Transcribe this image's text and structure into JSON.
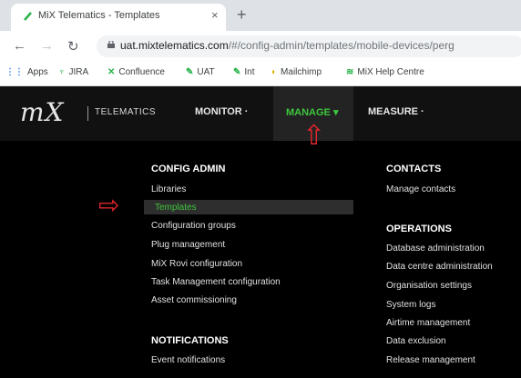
{
  "browser": {
    "tab_title": "MiX Telematics - Templates",
    "tab_close": "×",
    "new_tab": "+",
    "nav": {
      "back": "←",
      "forward": "→",
      "reload": "↻"
    },
    "url_host": "uat.mixtelematics.com",
    "url_path": "/#/config-admin/templates/mobile-devices/perg",
    "bookmarks": [
      {
        "icon": "apps-grid-icon",
        "glyph": "⋮⋮",
        "label": "Apps"
      },
      {
        "icon": "jira-icon",
        "glyph": "♆",
        "label": "JIRA"
      },
      {
        "icon": "confluence-icon",
        "glyph": "✕",
        "label": "Confluence"
      },
      {
        "icon": "leaf-icon",
        "glyph": "✎",
        "label": "UAT"
      },
      {
        "icon": "leaf-icon",
        "glyph": "✎",
        "label": "Int"
      },
      {
        "icon": "mailchimp-icon",
        "glyph": "◐",
        "label": "Mailchimp"
      },
      {
        "icon": "mix-help-icon",
        "glyph": "≋",
        "label": "MiX Help Centre"
      }
    ]
  },
  "app": {
    "logo": "mX",
    "brand_sub": "TELEMATICS",
    "menu": {
      "monitor": "MONITOR ·",
      "manage": "MANAGE ▾",
      "measure": "MEASURE ·"
    },
    "annotations": {
      "up_arrow": "⇧",
      "right_arrow": "⇨"
    },
    "config_admin": {
      "heading": "CONFIG ADMIN",
      "items": [
        "Libraries",
        "Templates",
        "Configuration groups",
        "Plug management",
        "MiX Rovi configuration",
        "Task Management configuration",
        "Asset commissioning"
      ]
    },
    "notifications": {
      "heading": "NOTIFICATIONS",
      "items": [
        "Event notifications"
      ]
    },
    "contacts": {
      "heading": "CONTACTS",
      "items": [
        "Manage contacts"
      ]
    },
    "operations": {
      "heading": "OPERATIONS",
      "items": [
        "Database administration",
        "Data centre administration",
        "Organisation settings",
        "System logs",
        "Airtime management",
        "Data exclusion",
        "Release management"
      ]
    },
    "colors": {
      "accent_green": "#3ec63e",
      "annotation_red": "#e0262c"
    }
  }
}
